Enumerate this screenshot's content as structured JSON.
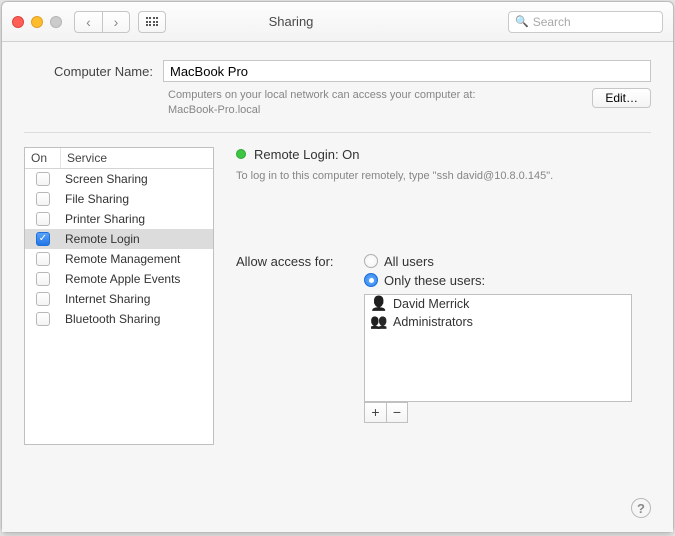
{
  "window": {
    "title": "Sharing"
  },
  "search": {
    "placeholder": "Search"
  },
  "computerName": {
    "label": "Computer Name:",
    "value": "MacBook Pro",
    "hint_line1": "Computers on your local network can access your computer at:",
    "hint_line2": "MacBook-Pro.local",
    "editLabel": "Edit…"
  },
  "services": {
    "head_on": "On",
    "head_service": "Service",
    "items": [
      {
        "label": "Screen Sharing",
        "checked": false,
        "selected": false
      },
      {
        "label": "File Sharing",
        "checked": false,
        "selected": false
      },
      {
        "label": "Printer Sharing",
        "checked": false,
        "selected": false
      },
      {
        "label": "Remote Login",
        "checked": true,
        "selected": true
      },
      {
        "label": "Remote Management",
        "checked": false,
        "selected": false
      },
      {
        "label": "Remote Apple Events",
        "checked": false,
        "selected": false
      },
      {
        "label": "Internet Sharing",
        "checked": false,
        "selected": false
      },
      {
        "label": "Bluetooth Sharing",
        "checked": false,
        "selected": false
      }
    ]
  },
  "detail": {
    "status": "Remote Login: On",
    "hint": "To log in to this computer remotely, type \"ssh david@10.8.0.145\".",
    "access_label": "Allow access for:",
    "radio_all": "All users",
    "radio_only": "Only these users:",
    "users": [
      {
        "name": "David Merrick",
        "type": "single"
      },
      {
        "name": "Administrators",
        "type": "group"
      }
    ],
    "plus": "+",
    "minus": "−"
  },
  "help": "?"
}
